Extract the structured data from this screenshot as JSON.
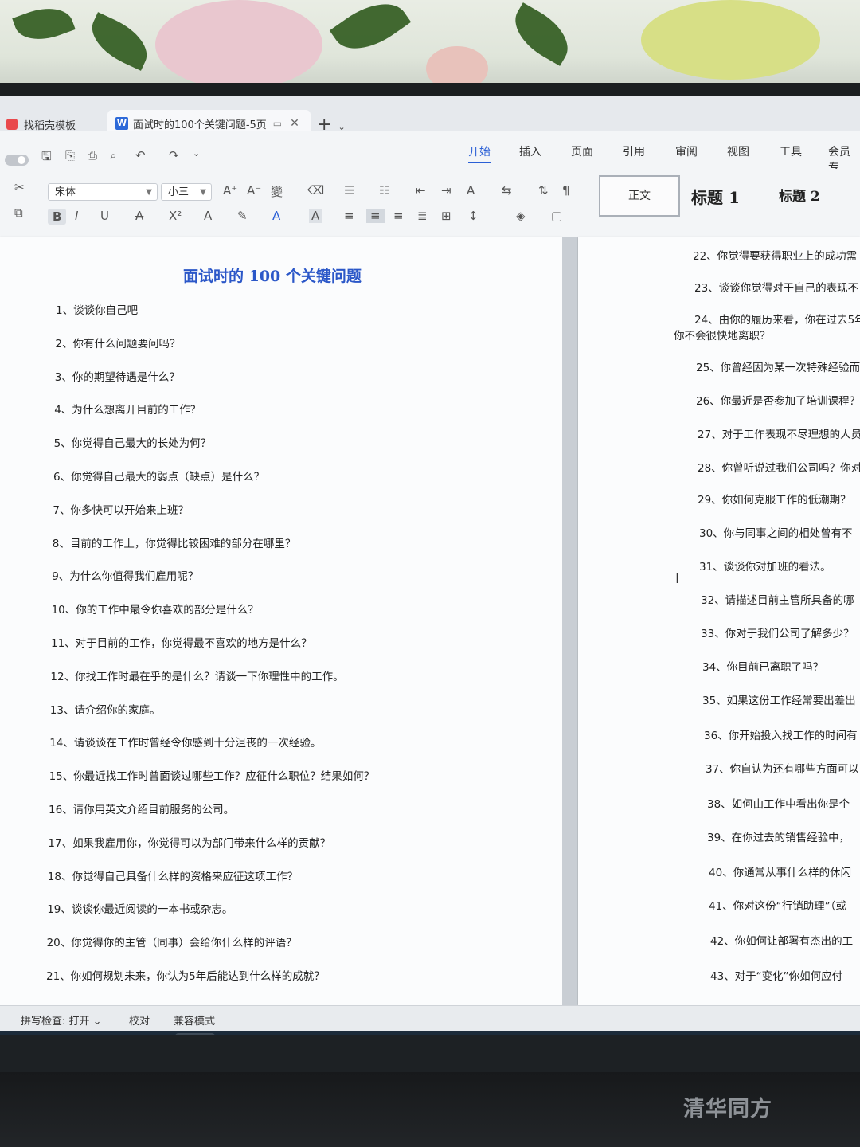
{
  "tabs": {
    "template_tab": "找稻壳模板",
    "doc_tab": "面试时的100个关键问题-5页",
    "new_tab": "+"
  },
  "menu": [
    "开始",
    "插入",
    "页面",
    "引用",
    "审阅",
    "视图",
    "工具",
    "会员专"
  ],
  "ribbon": {
    "font_name": "宋体",
    "font_size": "小三",
    "styles": [
      "正文",
      "标题 1",
      "标题 2"
    ]
  },
  "document": {
    "title": "面试时的 100 个关键问题",
    "left_questions": [
      "1、谈谈你自己吧",
      "2、你有什么问题要问吗？",
      "3、你的期望待遇是什么？",
      "4、为什么想离开目前的工作？",
      "5、你觉得自己最大的长处为何？",
      "6、你觉得自己最大的弱点（缺点）是什么？",
      "7、你多快可以开始来上班？",
      "8、目前的工作上，你觉得比较困难的部分在哪里？",
      "9、为什么你值得我们雇用呢？",
      "10、你的工作中最令你喜欢的部分是什么？",
      "11、对于目前的工作，你觉得最不喜欢的地方是什么？",
      "12、你找工作时最在乎的是什么？请谈一下你理性中的工作。",
      "13、请介绍你的家庭。",
      "14、请谈谈在工作时曾经令你感到十分沮丧的一次经验。",
      "15、你最近找工作时曾面谈过哪些工作？应征什么职位？结果如何？",
      "16、请你用英文介绍目前服务的公司。",
      "17、如果我雇用你，你觉得可以为部门带来什么样的贡献？",
      "18、你觉得自己具备什么样的资格来应征这项工作？",
      "19、谈谈你最近阅读的一本书或杂志。",
      "20、你觉得你的主管（同事）会给你什么样的评语？",
      "21、你如何规划未来，你认为5年后能达到什么样的成就？"
    ],
    "right_questions": [
      "22、你觉得要获得职业上的成功需",
      "23、谈谈你觉得对于自己的表现不",
      "24、由你的履历来看，你在过去5年",
      "你不会很快地离职？",
      "25、你曾经因为某一次特殊经验而",
      "26、你最近是否参加了培训课程？",
      "27、对于工作表现不尽理想的人员",
      "28、你曾听说过我们公司吗？你对",
      "29、你如何克服工作的低潮期？",
      "30、你与同事之间的相处曾有不",
      "31、谈谈你对加班的看法。",
      "32、请描述目前主管所具备的哪",
      "33、你对于我们公司了解多少？",
      "34、你目前已离职了吗？",
      "35、如果这份工作经常要出差出",
      "36、你开始投入找工作的时间有",
      "37、你自认为还有哪些方面可以",
      "38、如何由工作中看出你是个",
      "39、在你过去的销售经验中，",
      "40、你通常从事什么样的休闲",
      "41、你对这份“行销助理”（或",
      "42、你如何让部署有杰出的工",
      "43、对于“变化”你如何应付"
    ]
  },
  "status": {
    "spell_check": "拼写检查: 打开 ⌄",
    "proofread": "校对",
    "compat_mode": "兼容模式"
  },
  "taskbar_apps": [
    "browser-a",
    "chrome",
    "browser-b",
    "calculator",
    "wps",
    "search",
    "app-blue",
    "file-explorer"
  ],
  "monitor_brand": "清华同方",
  "colors": {
    "accent": "#2a5fd6",
    "title_blue": "#2b57c8",
    "wps_red": "#e9494c"
  }
}
